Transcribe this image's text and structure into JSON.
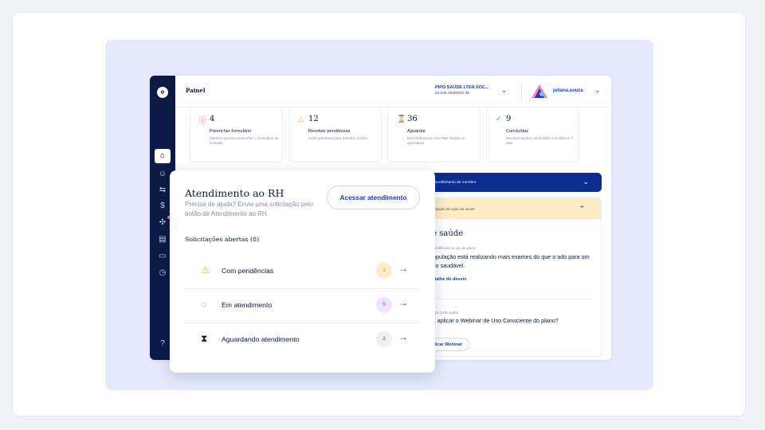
{
  "colors": {
    "navy": "#0d1a45",
    "accent_blue": "#1d3bbf",
    "banner_blue": "#0d2c8e",
    "warning_bg": "#fdedc6",
    "stage_bg": "#e4e9fb"
  },
  "sidebar": {
    "logo_letter": "e",
    "icons": [
      "home-icon",
      "smile-icon",
      "transfer-icon",
      "dollar-icon",
      "puzzle-icon",
      "document-icon",
      "wallet-icon",
      "clock-icon",
      "help-icon"
    ]
  },
  "header": {
    "title": "Painel",
    "company_name": "PIPO SAÚDE LTDA SOC...",
    "company_cnpj": "53.845.193/0002-38",
    "username": "juliana.souza"
  },
  "cards": [
    {
      "count": "4",
      "title": "Preencher formulário",
      "desc": "Membro precisa preencher o formulário de inclusão",
      "icon": "alert-circle-icon",
      "color": "#e5484d"
    },
    {
      "count": "12",
      "title": "Resolver pendências",
      "desc": "Ação pendente para membro ou RH",
      "icon": "warning-icon",
      "color": "#f0b429"
    },
    {
      "count": "36",
      "title": "Aguardar",
      "desc": "Em andamento com Pipo Saúde ou operadora",
      "icon": "hourglass-icon",
      "color": "#9b4dd8"
    },
    {
      "count": "9",
      "title": "Concluídas",
      "desc": "Movimentações concluídas nos últimos 7 dias",
      "icon": "check-icon",
      "color": "#2ebf6d"
    }
  ],
  "blue_banner": {
    "text": "r acolhimento de membro"
  },
  "health_panel": {
    "header": "ndação de ação de saúde",
    "title": "le saúde",
    "identified_label": "o identificado no uso do plano",
    "body": "população está realizando mais exames do que o ado para um uso saudável.",
    "detail_link": "detalhe do desvio",
    "help_label": "a Pipo pode ajudar",
    "question": "os aplicar o Webinar de Uso Consciente do plano?",
    "button": "plicar Webinar"
  },
  "popup": {
    "title": "Atendimento ao RH",
    "subtitle": "Precisa de ajuda? Envie uma solicitação pelo botão de Atendimento ao RH.",
    "button": "Acessar atendimento",
    "section_title": "Solicitações abertas (8)",
    "rows": [
      {
        "label": "Com pendências",
        "count": "1",
        "icon": "warning-icon",
        "icon_color": "#f0b429",
        "badge_bg": "#fdedc6",
        "badge_color": "#b8891a"
      },
      {
        "label": "Em atendimento",
        "count": "5",
        "icon": "chat-icon",
        "icon_color": "#9b4dd8",
        "badge_bg": "#efe2fb",
        "badge_color": "#8a3fc8"
      },
      {
        "label": "Aguardando atendimento",
        "count": "2",
        "icon": "hourglass-icon",
        "icon_color": "#0d1a45",
        "badge_bg": "#eef0f4",
        "badge_color": "#4a5068"
      }
    ]
  }
}
